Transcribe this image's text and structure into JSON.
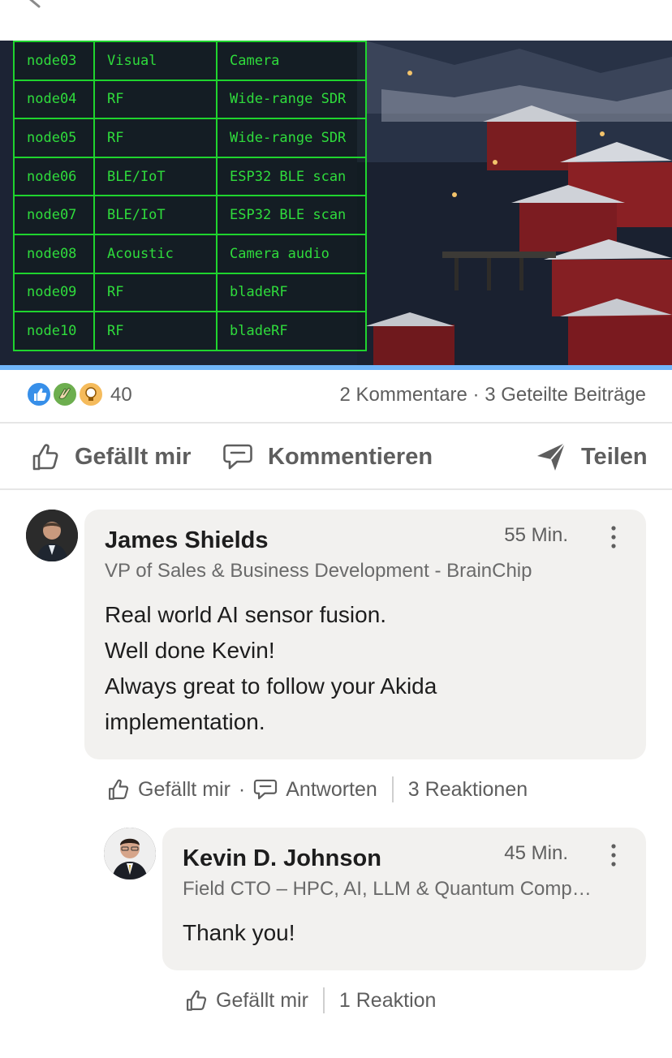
{
  "post_image": {
    "table_rows": [
      {
        "node": "node03",
        "type": "Visual",
        "device": "Camera"
      },
      {
        "node": "node04",
        "type": "RF",
        "device": "Wide-range SDR"
      },
      {
        "node": "node05",
        "type": "RF",
        "device": "Wide-range SDR"
      },
      {
        "node": "node06",
        "type": "BLE/IoT",
        "device": "ESP32 BLE scan"
      },
      {
        "node": "node07",
        "type": "BLE/IoT",
        "device": "ESP32 BLE scan"
      },
      {
        "node": "node08",
        "type": "Acoustic",
        "device": "Camera audio"
      },
      {
        "node": "node09",
        "type": "RF",
        "device": "bladeRF"
      },
      {
        "node": "node10",
        "type": "RF",
        "device": "bladeRF"
      }
    ]
  },
  "stats": {
    "reaction_count": "40",
    "comments_shares": "2 Kommentare · 3 Geteilte Beiträge",
    "reaction_icons": [
      "like-icon",
      "celebrate-clap-icon",
      "insightful-bulb-icon"
    ]
  },
  "actions": {
    "like": "Gefällt mir",
    "comment": "Kommentieren",
    "share": "Teilen"
  },
  "comments": [
    {
      "author": "James Shields",
      "time": "55 Min.",
      "headline": "VP of Sales & Business Development - BrainChip",
      "lines": [
        "Real world AI sensor fusion.",
        "Well done Kevin!",
        "Always great to follow your Akida",
        "implementation."
      ],
      "like_label": "Gefällt mir",
      "reply_label": "Antworten",
      "reactions": "3 Reaktionen"
    },
    {
      "author": "Kevin D. Johnson",
      "time": "45 Min.",
      "headline": "Field CTO – HPC, AI, LLM & Quantum Comp…",
      "lines": [
        "Thank you!"
      ],
      "like_label": "Gefällt mir",
      "reactions": "1 Reaktion"
    }
  ],
  "colors": {
    "accent_blue": "#70b5f9",
    "terminal_green": "#2fdc3c",
    "bubble_bg": "#f2f1ef"
  }
}
